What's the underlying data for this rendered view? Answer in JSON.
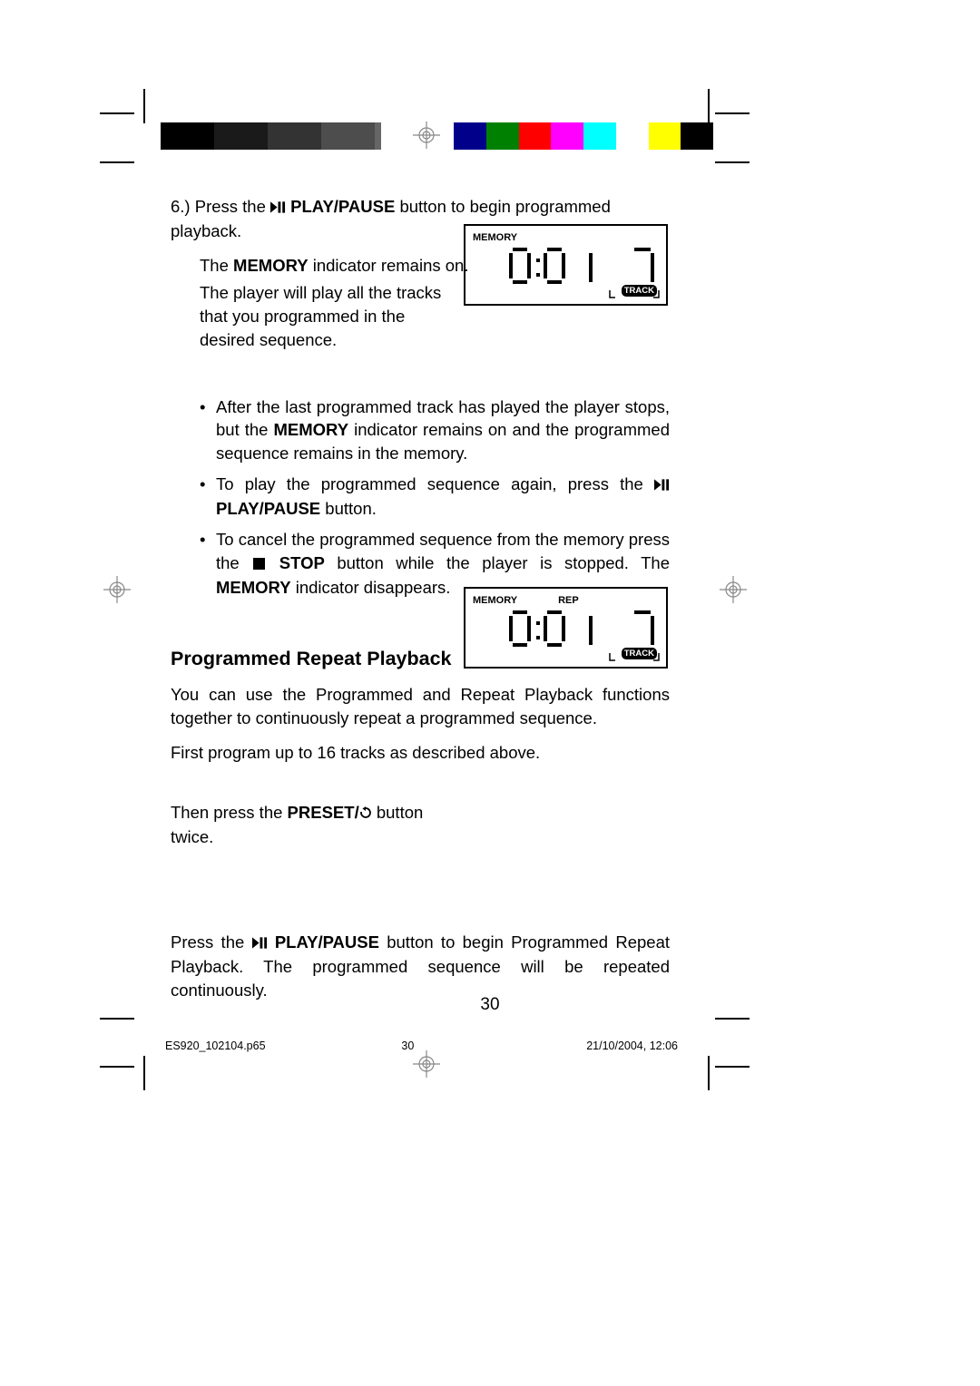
{
  "step6_prefix": "6.) Press the ",
  "play_pause_label": "PLAY/PAUSE",
  "step6_suffix": " button to begin programmed playback.",
  "memory_word": "MEMORY",
  "step6_line2a": "The ",
  "step6_line2b": " indicator remains on.",
  "step6_line3": "The player will play all the tracks that you programmed in the desired sequence.",
  "display1": {
    "memory": "MEMORY",
    "time": "0:0 1",
    "track": "7",
    "track_label": "TRACK"
  },
  "bullet1a": "After the last programmed track has played the player stops, but the ",
  "bullet1b": " indicator remains on and the programmed sequence remains in the memory.",
  "bullet2a": "To play the programmed sequence again, press the ",
  "bullet2b": " button.",
  "bullet3a": "To cancel the programmed sequence from the memory press the ",
  "stop_label": "STOP",
  "bullet3b": " button while the player is stopped. The ",
  "bullet3c": " indicator disappears.",
  "section_heading": "Programmed Repeat Playback",
  "section_para1": "You can use the Programmed and Repeat Playback functions together to continuously repeat a programmed sequence.",
  "section_para2": "First program up to 16 tracks as described above.",
  "preset_line_a": "Then press the ",
  "preset_word": "PRESET/",
  "preset_line_b": " button twice.",
  "display2": {
    "memory": "MEMORY",
    "rep": "REP",
    "time": "0:0 1",
    "track": "7",
    "track_label": "TRACK"
  },
  "final_para_a": "Press the ",
  "final_para_b": " button to begin Programmed Repeat Playback. The programmed sequence will be repeated continuously.",
  "page_number": "30",
  "footer_file": "ES920_102104.p65",
  "footer_page": "30",
  "footer_date": "21/10/2004, 12:06"
}
